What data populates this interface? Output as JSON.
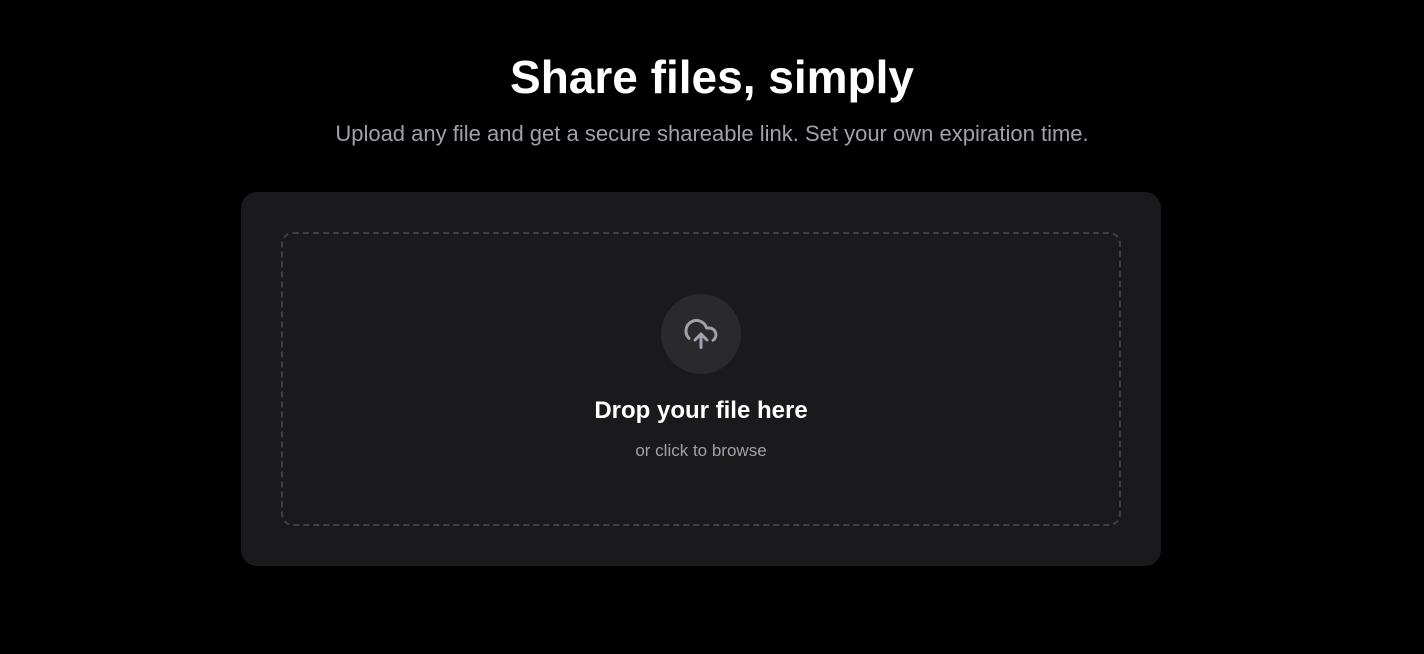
{
  "hero": {
    "title": "Share files, simply",
    "subtitle": "Upload any file and get a secure shareable link. Set your own expiration time."
  },
  "upload": {
    "icon": "cloud-upload-icon",
    "title": "Drop your file here",
    "hint": "or click to browse"
  },
  "colors": {
    "background": "#000000",
    "card": "#1a1a1c",
    "icon_circle": "#2a2a2d",
    "dashed_border": "#3f3f46",
    "muted_text": "#a1a1aa",
    "primary_text": "#ffffff"
  }
}
